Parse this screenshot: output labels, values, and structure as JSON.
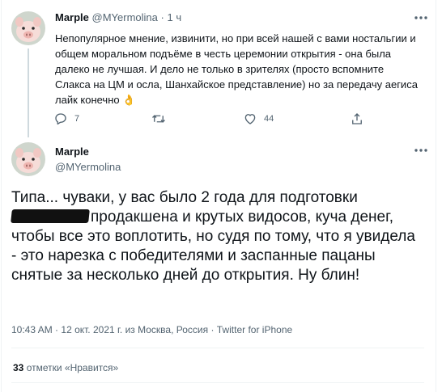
{
  "reply": {
    "name": "Marple",
    "handle": "@MYermolina",
    "separator": "·",
    "time": "1 ч",
    "text": "Непопулярное мнение, извинити, но при всей нашей с вами ностальгии и общем моральном подъёме в честь церемонии открытия - она была далеко не лучшая. И дело не только в зрителях (просто вспомните Слакса на ЦМ и осла, Шанхайское представление) но за передачу аегиса лайк конечно",
    "emoji": "👌",
    "reply_count": "7",
    "retweet_count": "",
    "like_count": "44"
  },
  "tweet": {
    "name": "Marple",
    "handle": "@MYermolina",
    "text_before": "Типа... чуваки, у вас было 2 года для подготовки",
    "text_after": "продакшена и крутых видосов, куча денег, чтобы все это воплотить, но судя по тому, что я увидела - это нарезка с победителями и заспанные пацаны снятые за несколько дней до открытия. Ну блин!",
    "time": "10:43 AM",
    "date": "12 окт. 2021 г. из Москва, Россия",
    "dot": "·",
    "source": "Twitter for iPhone",
    "likes_count": "33",
    "likes_label": "отметки «Нравится»"
  },
  "colors": {
    "text": "#0f1419",
    "muted": "#536471",
    "border": "#eff3f4"
  }
}
